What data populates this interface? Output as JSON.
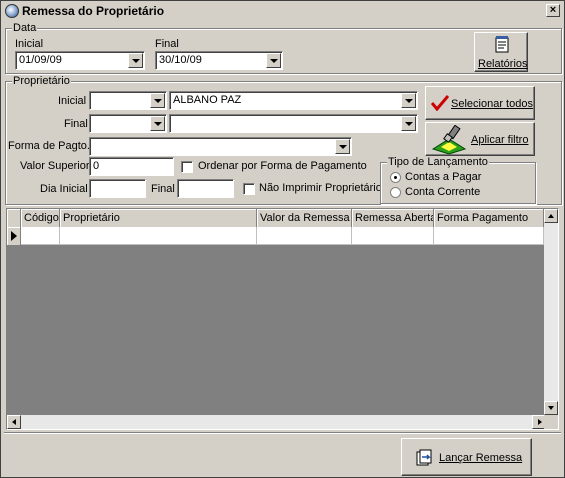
{
  "window": {
    "title": "Remessa do Proprietário",
    "close_label": "×"
  },
  "data_group": {
    "legend": "Data",
    "inicial_label": "Inicial",
    "inicial_value": "01/09/09",
    "final_label": "Final",
    "final_value": "30/10/09"
  },
  "relatorios_button": {
    "label": "Relatórios",
    "icon": "report-icon"
  },
  "proprietario_group": {
    "legend": "Proprietário",
    "inicial_label": "Inicial",
    "inicial_code": "",
    "inicial_name": "ALBANO PAZ",
    "final_label": "Final",
    "final_code": "",
    "final_name": "",
    "forma_pagto_label": "Forma de Pagto.",
    "forma_pagto_value": "",
    "valor_superior_label": "Valor Superior",
    "valor_superior_value": "0",
    "ordenar_label": "Ordenar por Forma de Pagamento",
    "ordenar_checked": false,
    "dia_inicial_label": "Dia Inicial",
    "dia_inicial_value": "",
    "dia_final_label": "Final",
    "dia_final_value": "",
    "nao_imprimir_label": "Não Imprimir Proprietário",
    "nao_imprimir_checked": false
  },
  "selecionar_todos_button": {
    "label": "Selecionar todos",
    "icon": "checkmark-icon"
  },
  "aplicar_filtro_button": {
    "label": "Aplicar filtro",
    "icon": "paint-brush-icon"
  },
  "tipo_lancamento": {
    "legend": "Tipo de Lançamento",
    "options": [
      "Contas a Pagar",
      "Conta Corrente"
    ],
    "selected": "Contas a Pagar"
  },
  "grid": {
    "columns": [
      "Código",
      "Proprietário",
      "Valor da Remessa",
      "Remessa Aberta",
      "Forma Pagamento"
    ],
    "rows": [
      [
        "",
        "",
        "",
        "",
        ""
      ]
    ]
  },
  "lancar_remessa_button": {
    "label": "Lançar Remessa",
    "icon": "post-document-icon"
  },
  "colors": {
    "window_bg": "#d4d0c8",
    "check_red": "#cc0000"
  }
}
